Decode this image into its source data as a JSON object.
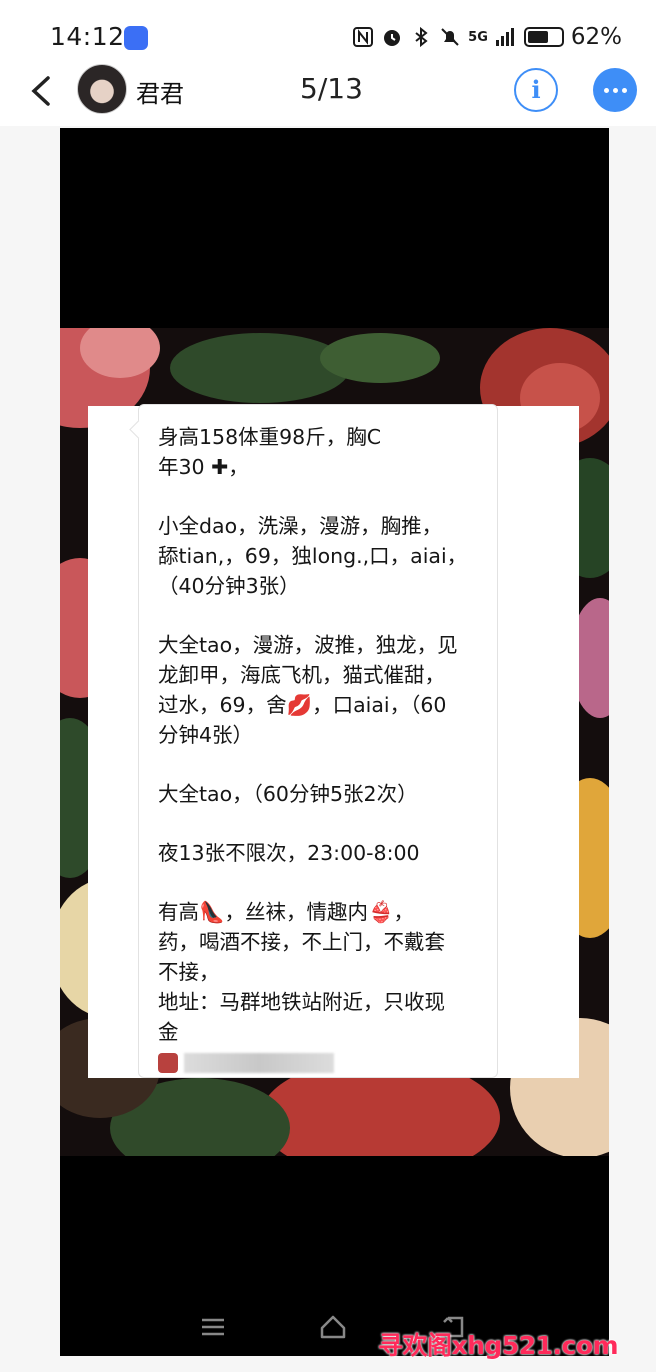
{
  "status_bar": {
    "time": "14:12",
    "network": "5G",
    "battery_percent": "62%",
    "battery_level": 0.62,
    "icons": [
      "nfc-icon",
      "alarm-icon",
      "bluetooth-icon",
      "mute-icon",
      "signal-icon",
      "battery-icon"
    ]
  },
  "nav": {
    "contact_name": "君君",
    "page_counter": "5/13",
    "info_label": "i"
  },
  "message": {
    "lines": [
      [
        "身高158体重98斤，胸C",
        "年30 ✚，"
      ],
      [
        "小全dao，洗澡，漫游，胸推，",
        "舔tian,，69，独long.,口，aiai，",
        "（40分钟3张）"
      ],
      [
        "大全tao，漫游，波推，独龙，见",
        "龙卸甲，海底飞机，猫式催甜，",
        "过水，69，舍💋，口aiai，（60",
        "分钟4张）"
      ],
      [
        "大全tao，（60分钟5张2次）"
      ],
      [
        "夜13张不限次，23:00-8:00"
      ],
      [
        "有高👠，丝袜，情趣内👙，",
        "药，喝酒不接，不上门，不戴套",
        "不接，",
        "地址：马群地铁站附近，只收现",
        "金"
      ]
    ]
  },
  "watermark": "寻欢阁xhg521.com",
  "colors": {
    "accent": "#3e8ef7",
    "watermark": "#ff2a5a"
  }
}
